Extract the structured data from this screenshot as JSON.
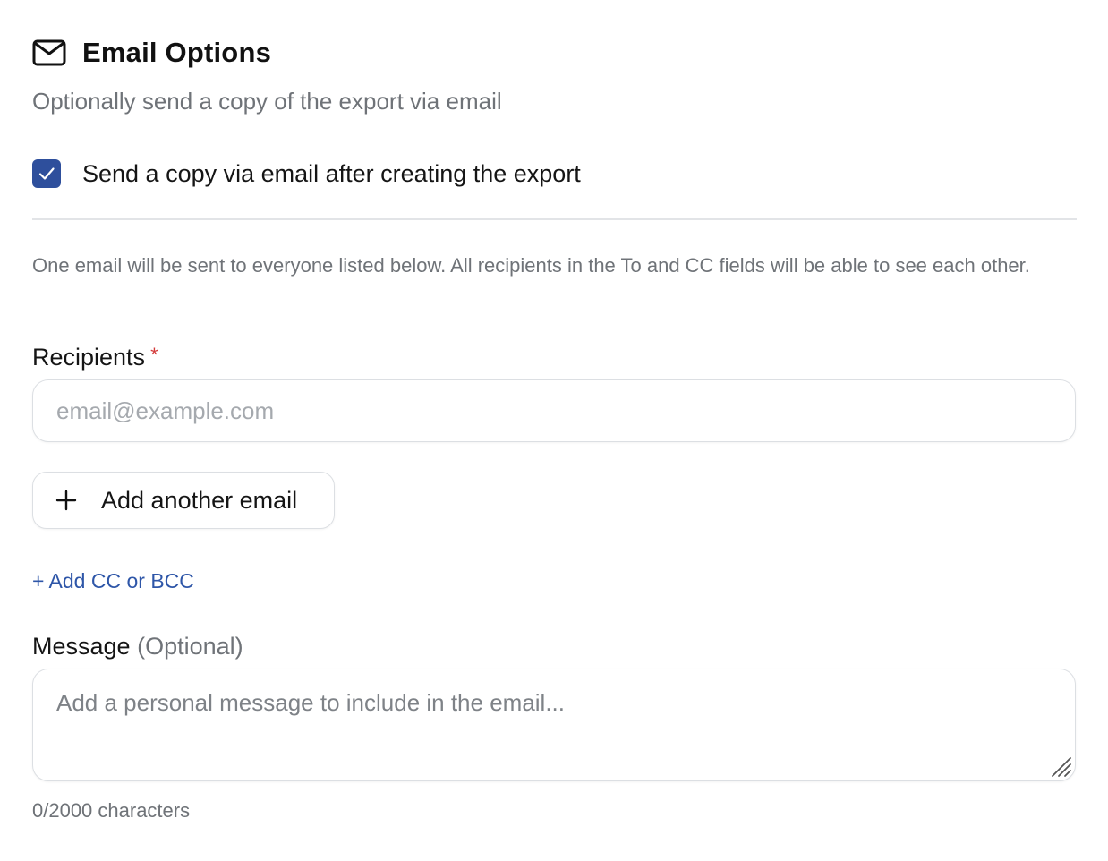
{
  "section": {
    "title": "Email Options",
    "subtitle": "Optionally send a copy of the export via email",
    "icon": "mail-icon"
  },
  "send_copy": {
    "label": "Send a copy via email after creating the export",
    "checked": true,
    "accent": "#2e4f9c"
  },
  "info_text": "One email will be sent to everyone listed below. All recipients in the To and CC fields will be able to see each other.",
  "recipients": {
    "label": "Recipients",
    "required_mark": "*",
    "value": "",
    "placeholder": "email@example.com"
  },
  "add_email_button": {
    "label": "Add another email",
    "icon": "plus-icon"
  },
  "cc_link": {
    "label": "+ Add CC or BCC",
    "color": "#2e56a8"
  },
  "message": {
    "label": "Message",
    "optional_text": "(Optional)",
    "value": "",
    "placeholder": "Add a personal message to include in the email...",
    "counter": "0/2000 characters"
  }
}
